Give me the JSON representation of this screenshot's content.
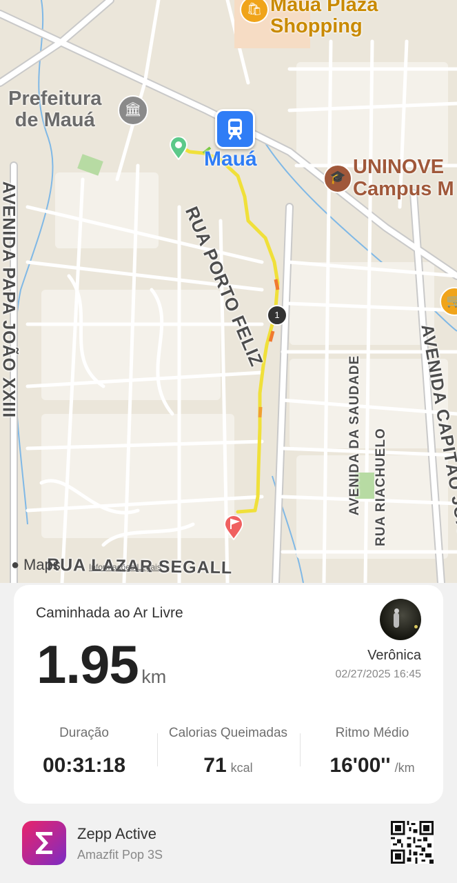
{
  "map": {
    "places": {
      "shopping": "Mauá Plaza\nShopping",
      "shopping_line1": "Mauá Plaza",
      "shopping_line2": "Shopping",
      "prefeitura_line1": "Prefeitura",
      "prefeitura_line2": "de Mauá",
      "station": "Mauá",
      "uninove_line1": "UNINOVE",
      "uninove_line2": "Campus M"
    },
    "streets": {
      "papa_joao": "AVENIDA PAPA JOÃO XXIII",
      "porto_feliz": "RUA PORTO FELIZ",
      "saudade": "AVENIDA DA SAUDADE",
      "riachuelo": "RUA RIACHUELO",
      "capitao_joao": "AVENIDA CAPITÃO JOÃO",
      "lazar_segall": "RUA LAZAR SEGALL"
    },
    "attribution": "Maps",
    "legal_link": "Informações Legais",
    "km_marker": "1",
    "colors": {
      "route_slow": "#f0e03a",
      "route_fast": "#f0a030",
      "start_pin": "#5cc98a",
      "end_pin": "#f06060",
      "station_icon": "#2f7df6"
    }
  },
  "workout": {
    "type": "Caminhada ao Ar Livre",
    "distance": "1.95",
    "distance_unit": "km",
    "user_name": "Verônica",
    "datetime": "02/27/2025 16:45",
    "stats": [
      {
        "label": "Duração",
        "value": "00:31:18",
        "unit": ""
      },
      {
        "label": "Calorias Queimadas",
        "value": "71",
        "unit": "kcal"
      },
      {
        "label": "Ritmo Médio",
        "value": "16'00''",
        "unit": "/km"
      }
    ]
  },
  "footer": {
    "app_name": "Zepp Active",
    "device": "Amazfit Pop 3S",
    "app_icon": "zepp-sigma-icon",
    "colors": {
      "icon_start": "#e8246a",
      "icon_end": "#7b2cc4"
    }
  }
}
